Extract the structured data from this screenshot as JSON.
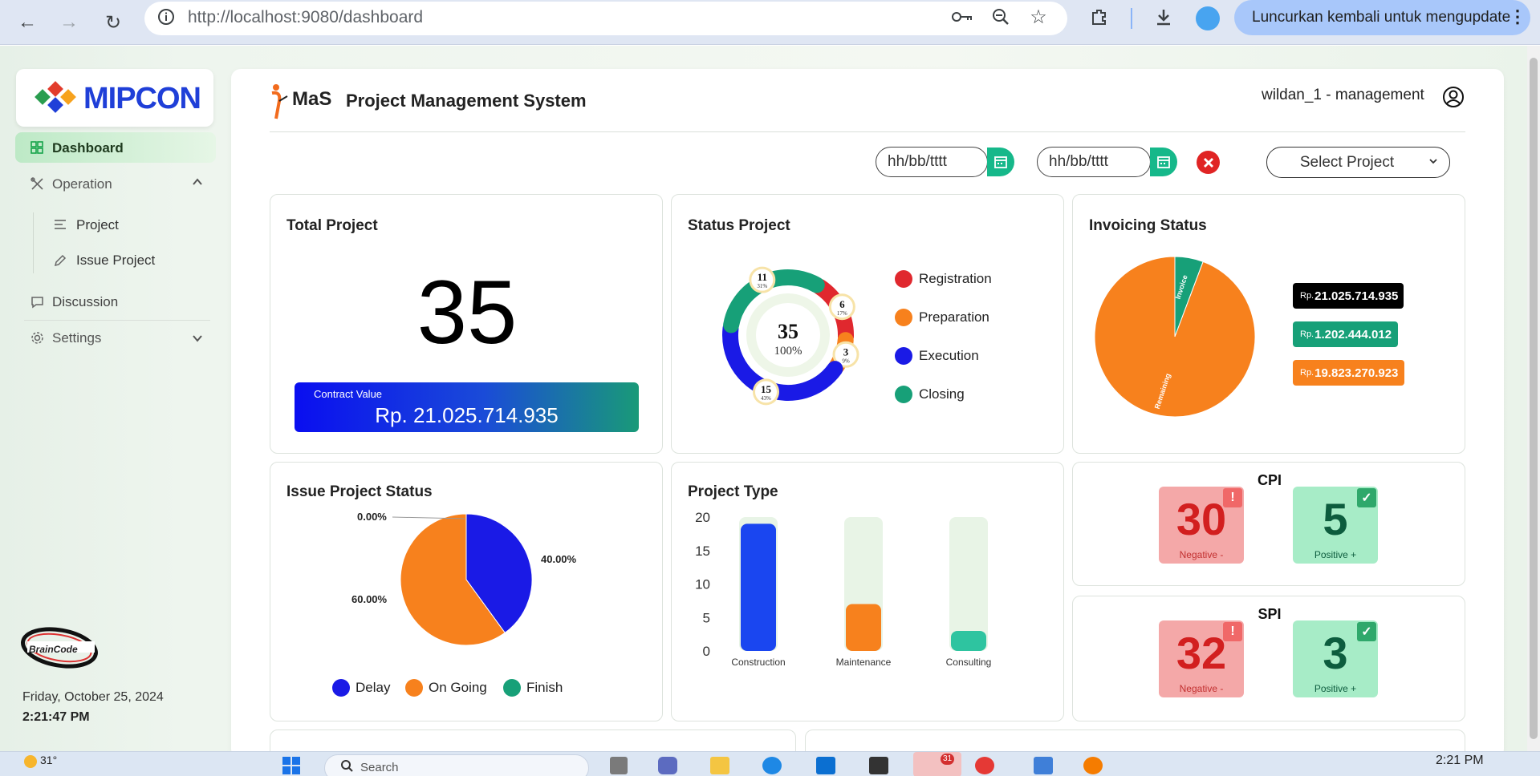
{
  "browser": {
    "url": "http://localhost:9080/dashboard",
    "update_label": "Luncurkan kembali untuk mengupdate"
  },
  "sidebar": {
    "logo_text": "MIPCON",
    "items": [
      {
        "label": "Dashboard"
      },
      {
        "label": "Operation"
      },
      {
        "label": "Project"
      },
      {
        "label": "Issue Project"
      },
      {
        "label": "Discussion"
      },
      {
        "label": "Settings"
      }
    ],
    "brand_logo_text": "BrainCode",
    "date": "Friday, October 25, 2024",
    "time": "2:21:47 PM"
  },
  "header": {
    "app_logo_text": "MaS",
    "title": "Project Management System",
    "user": "wildan_1 - management"
  },
  "filters": {
    "date_start": "hh/bb/tttt",
    "date_end": "hh/bb/tttt",
    "project_select": "Select Project"
  },
  "total_project": {
    "title": "Total Project",
    "value": "35",
    "contract_label": "Contract Value",
    "contract_value": "Rp. 21.025.714.935"
  },
  "status_project": {
    "title": "Status Project",
    "center_value": "35",
    "center_pct": "100%",
    "segments": [
      {
        "name": "Registration",
        "value": "6",
        "pct": "17%",
        "color": "#e0282e"
      },
      {
        "name": "Preparation",
        "value": "3",
        "pct": "9%",
        "color": "#f7811d"
      },
      {
        "name": "Execution",
        "value": "15",
        "pct": "43%",
        "color": "#1a1ae6"
      },
      {
        "name": "Closing",
        "value": "11",
        "pct": "31%",
        "color": "#17a078"
      }
    ]
  },
  "invoicing": {
    "title": "Invoicing Status",
    "slice_labels": {
      "invoice": "Invoice",
      "remaining": "Remaining"
    },
    "badges": [
      {
        "prefix": "Rp.",
        "value": "21.025.714.935",
        "color": "#000000"
      },
      {
        "prefix": "Rp.",
        "value": "1.202.444.012",
        "color": "#17a078"
      },
      {
        "prefix": "Rp.",
        "value": "19.823.270.923",
        "color": "#f7811d"
      }
    ]
  },
  "issue_status": {
    "title": "Issue Project Status",
    "labels": {
      "finish_pct": "0.00%",
      "delay_pct": "40.00%",
      "ongoing_pct": "60.00%"
    },
    "legend": [
      {
        "name": "Delay",
        "color": "#1a1ae6"
      },
      {
        "name": "On Going",
        "color": "#f7811d"
      },
      {
        "name": "Finish",
        "color": "#17a078"
      }
    ]
  },
  "project_type": {
    "title": "Project Type",
    "yticks": [
      "20",
      "15",
      "10",
      "5",
      "0"
    ],
    "categories": [
      "Construction",
      "Maintenance",
      "Consulting"
    ]
  },
  "cpi": {
    "title": "CPI",
    "negative": "30",
    "negative_label": "Negative -",
    "positive": "5",
    "positive_label": "Positive +"
  },
  "spi": {
    "title": "SPI",
    "negative": "32",
    "negative_label": "Negative -",
    "positive": "3",
    "positive_label": "Positive +"
  },
  "taskbar": {
    "temp": "31°",
    "search": "Search",
    "time": "2:21 PM",
    "badge": "31"
  },
  "chart_data": [
    {
      "type": "pie",
      "title": "Status Project",
      "categories": [
        "Registration",
        "Preparation",
        "Execution",
        "Closing"
      ],
      "values": [
        6,
        3,
        15,
        11
      ]
    },
    {
      "type": "pie",
      "title": "Invoicing Status",
      "categories": [
        "Invoice",
        "Remaining"
      ],
      "values": [
        1202444012,
        19823270923
      ]
    },
    {
      "type": "pie",
      "title": "Issue Project Status",
      "categories": [
        "Delay",
        "On Going",
        "Finish"
      ],
      "values": [
        40,
        60,
        0
      ]
    },
    {
      "type": "bar",
      "title": "Project Type",
      "categories": [
        "Construction",
        "Maintenance",
        "Consulting"
      ],
      "values": [
        19,
        7,
        3
      ],
      "ylim": [
        0,
        20
      ]
    }
  ]
}
